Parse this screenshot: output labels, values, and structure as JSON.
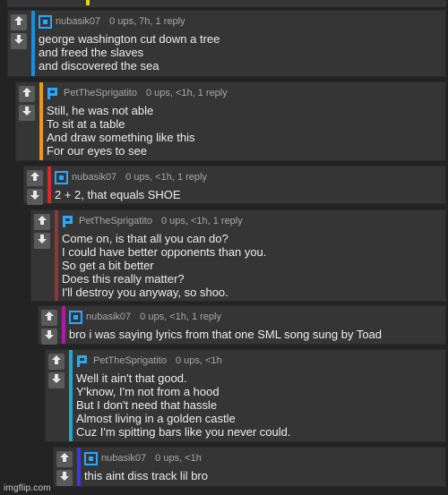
{
  "colors": {
    "background": "#232323",
    "card": "#353535",
    "vote_button": "#5a5a5a",
    "text": "#ededed",
    "meta": "#a8a8a8",
    "top_stub": "#e8d21a"
  },
  "icons": {
    "upvote": "up-arrow-icon",
    "downvote": "down-arrow-icon",
    "avatar_nubasik": "square-target-avatar",
    "avatar_pet": "pixel-p-avatar"
  },
  "comments": [
    {
      "username": "nubasik07",
      "meta": "0 ups, 7h, 1 reply",
      "bar_color": "#1a8fd8",
      "avatar": "square-target-avatar",
      "lines": [
        "george washington cut down a tree",
        "and freed the slaves",
        "and discovered the sea"
      ]
    },
    {
      "username": "PetTheSprigatito",
      "meta": "0 ups, <1h, 1 reply",
      "bar_color": "#e89a1a",
      "avatar": "pixel-p-avatar",
      "lines": [
        "Still, he was not able",
        "To sit at a table",
        "And draw something like this",
        "For our eyes to see"
      ]
    },
    {
      "username": "nubasik07",
      "meta": "0 ups, <1h, 1 reply",
      "bar_color": "#d42a2a",
      "avatar": "square-target-avatar",
      "lines": [
        "2 + 2, that equals SHOE"
      ]
    },
    {
      "username": "PetTheSprigatito",
      "meta": "0 ups, <1h, 1 reply",
      "bar_color": "#8a3a3a",
      "avatar": "pixel-p-avatar",
      "lines": [
        "Come on, is that all you can do?",
        "I could have better opponents than you.",
        "So get a bit better",
        "Does this really matter?",
        "I'll destroy you anyway, so shoo."
      ]
    },
    {
      "username": "nubasik07",
      "meta": "0 ups, <1h, 1 reply",
      "bar_color": "#b01aa8",
      "avatar": "square-target-avatar",
      "lines": [
        "bro i was saying lyrics from that one SML song sung by Toad"
      ]
    },
    {
      "username": "PetTheSprigatito",
      "meta": "0 ups, <1h",
      "bar_color": "#1aa8d8",
      "avatar": "pixel-p-avatar",
      "lines": [
        "Well it ain't that good.",
        "Y'know, I'm not from a hood",
        "But I don't need that hassle",
        "Almost living in a golden castle",
        "Cuz I'm spitting bars like you never could."
      ]
    },
    {
      "username": "nubasik07",
      "meta": "0 ups, <1h",
      "bar_color": "#3a3ae0",
      "avatar": "square-target-avatar",
      "lines": [
        "this aint diss track lil bro"
      ]
    }
  ],
  "watermark": "imgflip.com"
}
